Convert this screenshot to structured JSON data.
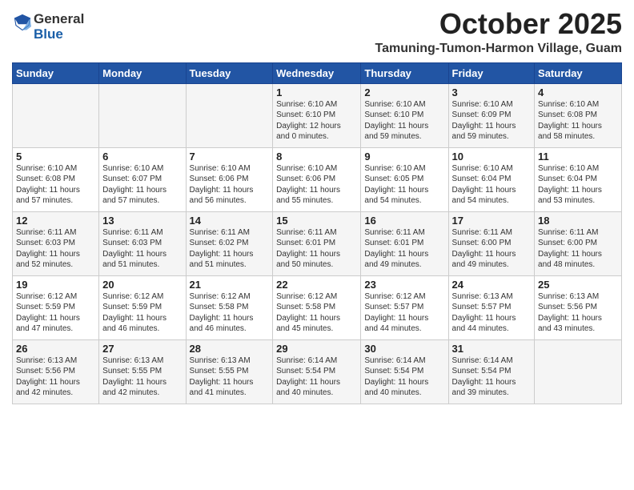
{
  "header": {
    "logo_general": "General",
    "logo_blue": "Blue",
    "month": "October 2025",
    "location": "Tamuning-Tumon-Harmon Village, Guam"
  },
  "weekdays": [
    "Sunday",
    "Monday",
    "Tuesday",
    "Wednesday",
    "Thursday",
    "Friday",
    "Saturday"
  ],
  "weeks": [
    [
      {
        "day": "",
        "info": ""
      },
      {
        "day": "",
        "info": ""
      },
      {
        "day": "",
        "info": ""
      },
      {
        "day": "1",
        "info": "Sunrise: 6:10 AM\nSunset: 6:10 PM\nDaylight: 12 hours\nand 0 minutes."
      },
      {
        "day": "2",
        "info": "Sunrise: 6:10 AM\nSunset: 6:10 PM\nDaylight: 11 hours\nand 59 minutes."
      },
      {
        "day": "3",
        "info": "Sunrise: 6:10 AM\nSunset: 6:09 PM\nDaylight: 11 hours\nand 59 minutes."
      },
      {
        "day": "4",
        "info": "Sunrise: 6:10 AM\nSunset: 6:08 PM\nDaylight: 11 hours\nand 58 minutes."
      }
    ],
    [
      {
        "day": "5",
        "info": "Sunrise: 6:10 AM\nSunset: 6:08 PM\nDaylight: 11 hours\nand 57 minutes."
      },
      {
        "day": "6",
        "info": "Sunrise: 6:10 AM\nSunset: 6:07 PM\nDaylight: 11 hours\nand 57 minutes."
      },
      {
        "day": "7",
        "info": "Sunrise: 6:10 AM\nSunset: 6:06 PM\nDaylight: 11 hours\nand 56 minutes."
      },
      {
        "day": "8",
        "info": "Sunrise: 6:10 AM\nSunset: 6:06 PM\nDaylight: 11 hours\nand 55 minutes."
      },
      {
        "day": "9",
        "info": "Sunrise: 6:10 AM\nSunset: 6:05 PM\nDaylight: 11 hours\nand 54 minutes."
      },
      {
        "day": "10",
        "info": "Sunrise: 6:10 AM\nSunset: 6:04 PM\nDaylight: 11 hours\nand 54 minutes."
      },
      {
        "day": "11",
        "info": "Sunrise: 6:10 AM\nSunset: 6:04 PM\nDaylight: 11 hours\nand 53 minutes."
      }
    ],
    [
      {
        "day": "12",
        "info": "Sunrise: 6:11 AM\nSunset: 6:03 PM\nDaylight: 11 hours\nand 52 minutes."
      },
      {
        "day": "13",
        "info": "Sunrise: 6:11 AM\nSunset: 6:03 PM\nDaylight: 11 hours\nand 51 minutes."
      },
      {
        "day": "14",
        "info": "Sunrise: 6:11 AM\nSunset: 6:02 PM\nDaylight: 11 hours\nand 51 minutes."
      },
      {
        "day": "15",
        "info": "Sunrise: 6:11 AM\nSunset: 6:01 PM\nDaylight: 11 hours\nand 50 minutes."
      },
      {
        "day": "16",
        "info": "Sunrise: 6:11 AM\nSunset: 6:01 PM\nDaylight: 11 hours\nand 49 minutes."
      },
      {
        "day": "17",
        "info": "Sunrise: 6:11 AM\nSunset: 6:00 PM\nDaylight: 11 hours\nand 49 minutes."
      },
      {
        "day": "18",
        "info": "Sunrise: 6:11 AM\nSunset: 6:00 PM\nDaylight: 11 hours\nand 48 minutes."
      }
    ],
    [
      {
        "day": "19",
        "info": "Sunrise: 6:12 AM\nSunset: 5:59 PM\nDaylight: 11 hours\nand 47 minutes."
      },
      {
        "day": "20",
        "info": "Sunrise: 6:12 AM\nSunset: 5:59 PM\nDaylight: 11 hours\nand 46 minutes."
      },
      {
        "day": "21",
        "info": "Sunrise: 6:12 AM\nSunset: 5:58 PM\nDaylight: 11 hours\nand 46 minutes."
      },
      {
        "day": "22",
        "info": "Sunrise: 6:12 AM\nSunset: 5:58 PM\nDaylight: 11 hours\nand 45 minutes."
      },
      {
        "day": "23",
        "info": "Sunrise: 6:12 AM\nSunset: 5:57 PM\nDaylight: 11 hours\nand 44 minutes."
      },
      {
        "day": "24",
        "info": "Sunrise: 6:13 AM\nSunset: 5:57 PM\nDaylight: 11 hours\nand 44 minutes."
      },
      {
        "day": "25",
        "info": "Sunrise: 6:13 AM\nSunset: 5:56 PM\nDaylight: 11 hours\nand 43 minutes."
      }
    ],
    [
      {
        "day": "26",
        "info": "Sunrise: 6:13 AM\nSunset: 5:56 PM\nDaylight: 11 hours\nand 42 minutes."
      },
      {
        "day": "27",
        "info": "Sunrise: 6:13 AM\nSunset: 5:55 PM\nDaylight: 11 hours\nand 42 minutes."
      },
      {
        "day": "28",
        "info": "Sunrise: 6:13 AM\nSunset: 5:55 PM\nDaylight: 11 hours\nand 41 minutes."
      },
      {
        "day": "29",
        "info": "Sunrise: 6:14 AM\nSunset: 5:54 PM\nDaylight: 11 hours\nand 40 minutes."
      },
      {
        "day": "30",
        "info": "Sunrise: 6:14 AM\nSunset: 5:54 PM\nDaylight: 11 hours\nand 40 minutes."
      },
      {
        "day": "31",
        "info": "Sunrise: 6:14 AM\nSunset: 5:54 PM\nDaylight: 11 hours\nand 39 minutes."
      },
      {
        "day": "",
        "info": ""
      }
    ]
  ]
}
